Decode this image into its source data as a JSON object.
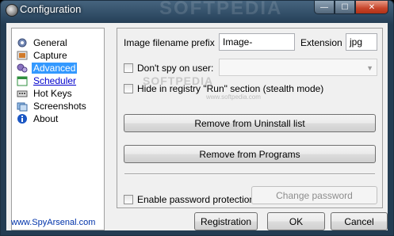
{
  "window": {
    "title": "Configuration",
    "watermark": "SOFTPEDIA",
    "controls": {
      "minimize": "—",
      "maximize": "☐",
      "close": "✕"
    }
  },
  "nav": {
    "items": [
      {
        "label": "General",
        "icon": "gear-icon",
        "color": "#5a6f9a"
      },
      {
        "label": "Capture",
        "icon": "capture-icon",
        "color": "#d07a2a"
      },
      {
        "label": "Advanced",
        "icon": "advanced-icon",
        "color": "#7a64b0"
      },
      {
        "label": "Scheduler",
        "icon": "scheduler-icon",
        "color": "#2f8f3f"
      },
      {
        "label": "Hot Keys",
        "icon": "keyboard-icon",
        "color": "#555555"
      },
      {
        "label": "Screenshots",
        "icon": "screenshots-icon",
        "color": "#4a7fc0"
      },
      {
        "label": "About",
        "icon": "about-icon",
        "color": "#1a56c4"
      }
    ],
    "selected": "Advanced",
    "site_link": "www.SpyArsenal.com"
  },
  "panel": {
    "filename_prefix_label": "Image filename prefix",
    "filename_prefix_value": "Image-",
    "extension_label": "Extension",
    "extension_value": "jpg",
    "dont_spy_label": "Don't spy on user:",
    "dont_spy_checked": false,
    "dont_spy_value": "",
    "hide_registry_label": "Hide in registry \"Run\" section (stealth mode)",
    "hide_registry_checked": false,
    "remove_uninstall_label": "Remove from Uninstall list",
    "remove_programs_label": "Remove from Programs",
    "enable_password_label": "Enable password protection",
    "enable_password_checked": false,
    "change_password_label": "Change password",
    "watermark": "SOFTPEDIA",
    "watermark_url": "www.softpedia.com"
  },
  "footer": {
    "registration_label": "Registration",
    "ok_label": "OK",
    "cancel_label": "Cancel"
  }
}
